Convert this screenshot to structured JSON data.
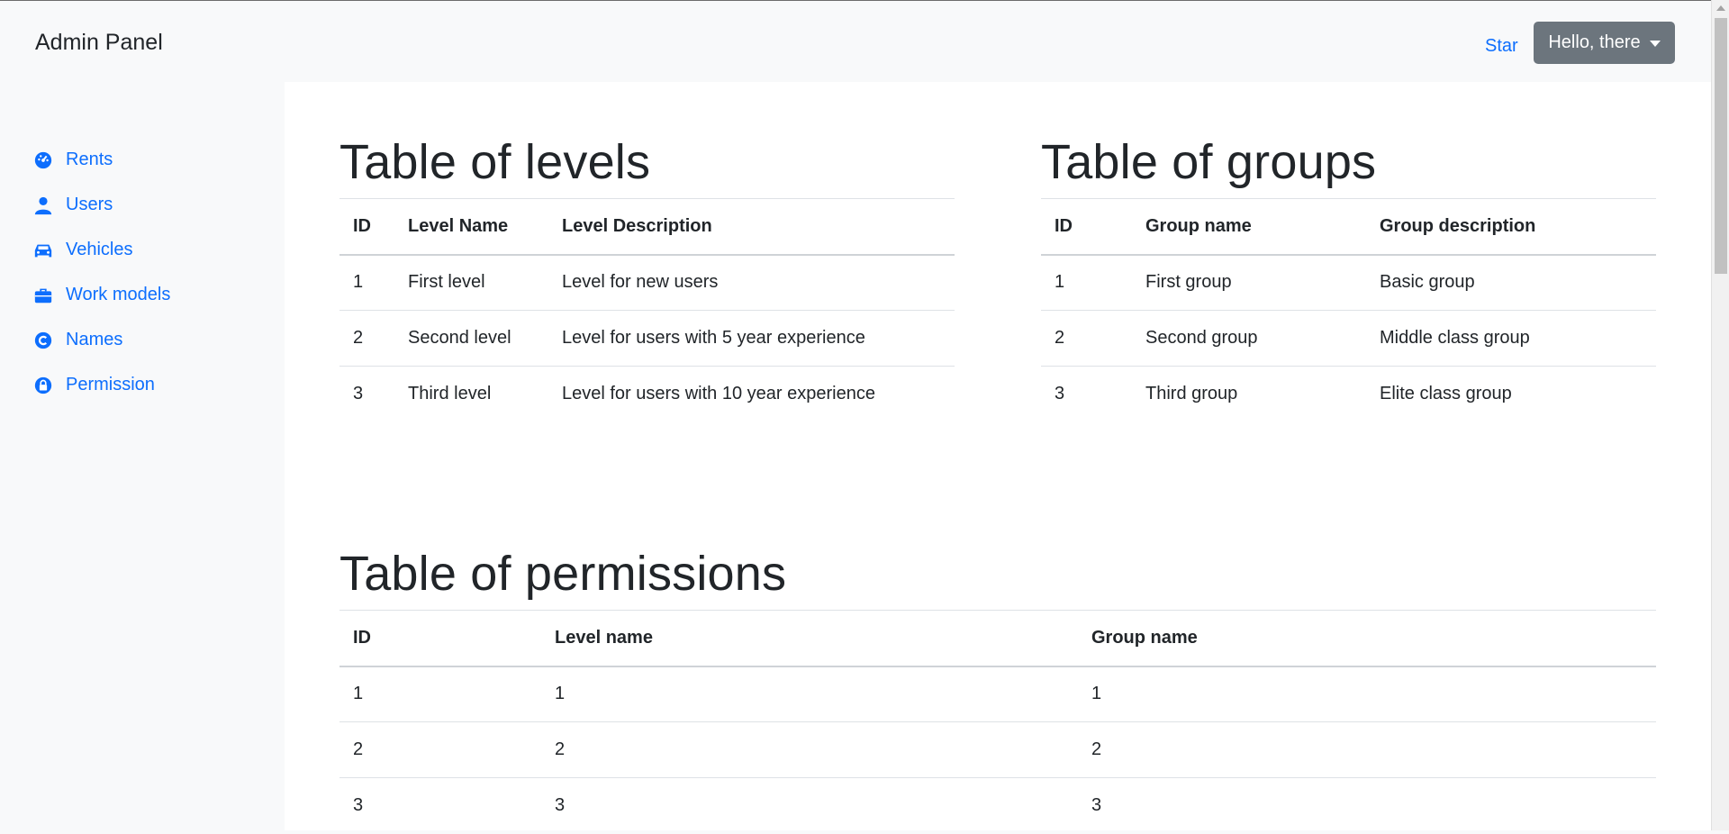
{
  "app": {
    "title": "Admin Panel"
  },
  "header": {
    "star_label": "Star",
    "user_button_label": "Hello, there"
  },
  "sidebar": {
    "items": [
      {
        "label": "Rents",
        "icon": "tachometer-icon"
      },
      {
        "label": "Users",
        "icon": "user-icon"
      },
      {
        "label": "Vehicles",
        "icon": "car-icon"
      },
      {
        "label": "Work models",
        "icon": "briefcase-icon"
      },
      {
        "label": "Names",
        "icon": "copyright-icon"
      },
      {
        "label": "Permission",
        "icon": "lock-icon"
      }
    ]
  },
  "levels": {
    "title": "Table of levels",
    "columns": [
      "ID",
      "Level Name",
      "Level Description"
    ],
    "rows": [
      [
        "1",
        "First level",
        "Level for new users"
      ],
      [
        "2",
        "Second level",
        "Level for users with 5 year experience"
      ],
      [
        "3",
        "Third level",
        "Level for users with 10 year experience"
      ]
    ]
  },
  "groups": {
    "title": "Table of groups",
    "columns": [
      "ID",
      "Group name",
      "Group description"
    ],
    "rows": [
      [
        "1",
        "First group",
        "Basic group"
      ],
      [
        "2",
        "Second group",
        "Middle class group"
      ],
      [
        "3",
        "Third group",
        "Elite class group"
      ]
    ]
  },
  "permissions": {
    "title": "Table of permissions",
    "columns": [
      "ID",
      "Level name",
      "Group name"
    ],
    "rows": [
      [
        "1",
        "1",
        "1"
      ],
      [
        "2",
        "2",
        "2"
      ],
      [
        "3",
        "3",
        "3"
      ]
    ]
  },
  "colors": {
    "accent": "#0d6efd",
    "button": "#6c757d",
    "text": "#212529",
    "sidebar_bg": "#f8f9fa"
  }
}
